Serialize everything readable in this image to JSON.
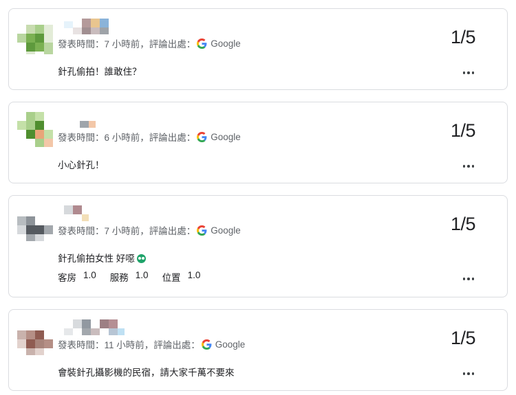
{
  "reviews": [
    {
      "time_label": "發表時間：7 小時前，評論出處：",
      "source": "Google",
      "rating": "1/5",
      "text": "針孔偷拍！誰敢住？",
      "colors": [
        "#c8dcb0",
        "#7bb152",
        "#5e9a3d",
        "#b9d6a0",
        "#e3ecd8"
      ]
    },
    {
      "time_label": "發表時間：6 小時前，評論出處：",
      "source": "Google",
      "rating": "1/5",
      "text": "小心針孔！",
      "colors": [
        "#a9cf8b",
        "#4f8e2f",
        "#e9a579",
        "#c4e0a8",
        "#f3c7a8"
      ]
    },
    {
      "time_label": "發表時間：7 小時前，評論出處：",
      "source": "Google",
      "rating": "1/5",
      "text": "針孔偷拍女性 好噁",
      "subratings": [
        {
          "label": "客房",
          "value": "1.0"
        },
        {
          "label": "服務",
          "value": "1.0"
        },
        {
          "label": "位置",
          "value": "1.0"
        }
      ],
      "colors": [
        "#b7bcc0",
        "#555a60",
        "#8d9399",
        "#d6d9dc",
        "#a3a8ad"
      ]
    },
    {
      "time_label": "發表時間：11 小時前，評論出處：",
      "source": "Google",
      "rating": "1/5",
      "text": "會裝針孔攝影機的民宿，請大家千萬不要來",
      "colors": [
        "#c9b2ac",
        "#8f5c52",
        "#b58f86",
        "#e2d2cd",
        "#a8847b"
      ]
    }
  ],
  "google_colors": {
    "blue": "#4285F4",
    "red": "#EA4335",
    "yellow": "#FBBC05",
    "green": "#34A853"
  }
}
